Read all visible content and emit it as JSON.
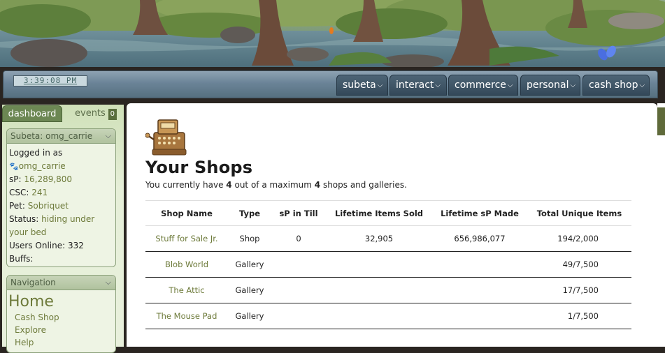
{
  "header": {
    "clock": "3:39:08 PM",
    "menus": [
      {
        "label": "subeta"
      },
      {
        "label": "interact"
      },
      {
        "label": "commerce"
      },
      {
        "label": "personal"
      },
      {
        "label": "cash shop"
      }
    ]
  },
  "sidebar": {
    "tabs": {
      "dashboard": "dashboard",
      "events": "events",
      "events_count": "0"
    },
    "user_panel": {
      "title": "Subeta: omg_carrie",
      "logged_in_label": "Logged in as",
      "username": "omg_carrie",
      "sp_label": "sP:",
      "sp_value": "16,289,800",
      "csc_label": "CSC:",
      "csc_value": "241",
      "pet_label": "Pet:",
      "pet_value": "Sobriquet",
      "status_label": "Status:",
      "status_value": "hiding under your bed",
      "users_online_label": "Users Online:",
      "users_online_value": "332",
      "buffs_label": "Buffs:"
    },
    "nav_panel": {
      "title": "Navigation",
      "home": "Home",
      "links": [
        "Cash Shop",
        "Explore",
        "Help"
      ]
    }
  },
  "main": {
    "title": "Your Shops",
    "summary_prefix": "You currently have ",
    "current": "4",
    "summary_middle": " out of a maximum ",
    "maximum": "4",
    "summary_suffix": " shops and galleries.",
    "columns": [
      "Shop Name",
      "Type",
      "sP in Till",
      "Lifetime Items Sold",
      "Lifetime sP Made",
      "Total Unique Items"
    ],
    "rows": [
      {
        "name": "Stuff for Sale Jr.",
        "type": "Shop",
        "till": "0",
        "sold": "32,905",
        "made": "656,986,077",
        "unique": "194/2,000"
      },
      {
        "name": "Blob World",
        "type": "Gallery",
        "till": "",
        "sold": "",
        "made": "",
        "unique": "49/7,500"
      },
      {
        "name": "The Attic",
        "type": "Gallery",
        "till": "",
        "sold": "",
        "made": "",
        "unique": "17/7,500"
      },
      {
        "name": "The Mouse Pad",
        "type": "Gallery",
        "till": "",
        "sold": "",
        "made": "",
        "unique": "1/7,500"
      }
    ]
  },
  "colors": {
    "accent_green": "#6d7a3a",
    "nav_blue": "#34495a",
    "tab_green": "#6c8753"
  },
  "icons": {
    "shop": "cash-register-icon",
    "menu_chevron": "chevron-down-icon",
    "user": "paw-icon",
    "decoration": "butterfly-icon"
  }
}
